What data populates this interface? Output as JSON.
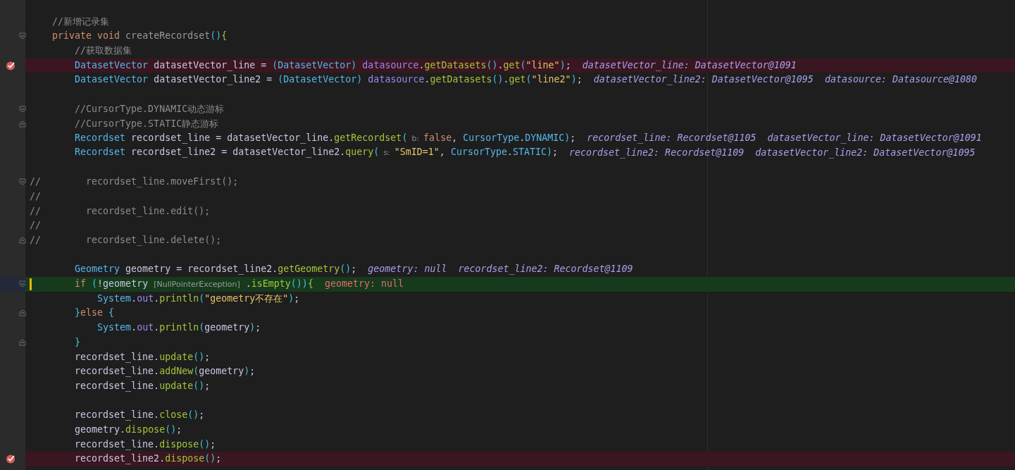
{
  "rows": [
    {
      "kind": "line",
      "breakpoint": false,
      "current": false
    },
    {
      "kind": "line",
      "breakpoint": false,
      "current": false,
      "indent": "    ",
      "tokens": [
        {
          "kind": "comment",
          "text": "//新增记录集"
        }
      ]
    },
    {
      "kind": "opener",
      "breakpoint": false,
      "current": false,
      "indent": "    ",
      "tokens": [
        {
          "kind": "keyword",
          "text": "private void "
        },
        {
          "kind": "unused",
          "text": "createRecordset"
        },
        {
          "kind": "paren",
          "text": "()"
        },
        {
          "kind": "brace",
          "text": "{"
        }
      ]
    },
    {
      "kind": "line",
      "breakpoint": false,
      "current": false,
      "indent": "        ",
      "tokens": [
        {
          "kind": "comment",
          "text": "//获取数据集"
        }
      ]
    },
    {
      "kind": "line",
      "breakpoint": true,
      "current": false,
      "indent": "        ",
      "tokens": [
        {
          "kind": "type",
          "text": "DatasetVector"
        },
        {
          "kind": "plain",
          "text": " datasetVector_line = "
        },
        {
          "kind": "paren",
          "text": "("
        },
        {
          "kind": "type",
          "text": "DatasetVector"
        },
        {
          "kind": "paren",
          "text": ")"
        },
        {
          "kind": "field",
          "text": " datasource"
        },
        {
          "kind": "plain",
          "text": "."
        },
        {
          "kind": "method",
          "text": "getDatasets"
        },
        {
          "kind": "paren",
          "text": "()"
        },
        {
          "kind": "plain",
          "text": "."
        },
        {
          "kind": "method",
          "text": "get"
        },
        {
          "kind": "paren",
          "text": "("
        },
        {
          "kind": "string",
          "text": "\"line\""
        },
        {
          "kind": "paren",
          "text": ")"
        },
        {
          "kind": "plain",
          "text": ";"
        }
      ],
      "values": [
        {
          "kind": "value",
          "text": "datasetVector_line: DatasetVector@1091"
        }
      ]
    },
    {
      "kind": "line",
      "breakpoint": false,
      "current": false,
      "indent": "        ",
      "tokens": [
        {
          "kind": "type",
          "text": "DatasetVector"
        },
        {
          "kind": "plain",
          "text": " datasetVector_line2 = "
        },
        {
          "kind": "paren",
          "text": "("
        },
        {
          "kind": "type",
          "text": "DatasetVector"
        },
        {
          "kind": "paren",
          "text": ")"
        },
        {
          "kind": "field",
          "text": " datasource"
        },
        {
          "kind": "plain",
          "text": "."
        },
        {
          "kind": "method",
          "text": "getDatasets"
        },
        {
          "kind": "paren",
          "text": "()"
        },
        {
          "kind": "plain",
          "text": "."
        },
        {
          "kind": "method",
          "text": "get"
        },
        {
          "kind": "paren",
          "text": "("
        },
        {
          "kind": "string",
          "text": "\"line2\""
        },
        {
          "kind": "paren",
          "text": ")"
        },
        {
          "kind": "plain",
          "text": ";"
        }
      ],
      "values": [
        {
          "kind": "value",
          "text": "datasetVector_line2: DatasetVector@1095"
        },
        {
          "kind": "value",
          "text": "datasource: Datasource@1080"
        }
      ]
    },
    {
      "kind": "line",
      "breakpoint": false,
      "current": false
    },
    {
      "kind": "opener",
      "breakpoint": false,
      "current": false,
      "indent": "        ",
      "tokens": [
        {
          "kind": "comment",
          "text": "//CursorType.DYNAMIC动态游标"
        }
      ]
    },
    {
      "kind": "closer",
      "breakpoint": false,
      "current": false,
      "indent": "        ",
      "tokens": [
        {
          "kind": "comment",
          "text": "//CursorType.STATIC静态游标"
        }
      ]
    },
    {
      "kind": "line",
      "breakpoint": false,
      "current": false,
      "indent": "        ",
      "tokens": [
        {
          "kind": "type",
          "text": "Recordset"
        },
        {
          "kind": "plain",
          "text": " recordset_line = datasetVector_line."
        },
        {
          "kind": "method",
          "text": "getRecordset"
        },
        {
          "kind": "paren",
          "text": "("
        },
        {
          "kind": "hint",
          "text": "b:"
        },
        {
          "kind": "keyword",
          "text": "false"
        },
        {
          "kind": "plain",
          "text": ", "
        },
        {
          "kind": "type",
          "text": "CursorType"
        },
        {
          "kind": "plain",
          "text": "."
        },
        {
          "kind": "constant",
          "text": "DYNAMIC"
        },
        {
          "kind": "paren",
          "text": ")"
        },
        {
          "kind": "plain",
          "text": ";"
        }
      ],
      "values": [
        {
          "kind": "value",
          "text": "recordset_line: Recordset@1105"
        },
        {
          "kind": "value",
          "text": "datasetVector_line: DatasetVector@1091"
        }
      ]
    },
    {
      "kind": "line",
      "breakpoint": false,
      "current": false,
      "indent": "        ",
      "tokens": [
        {
          "kind": "type",
          "text": "Recordset"
        },
        {
          "kind": "plain",
          "text": " recordset_line2 = datasetVector_line2."
        },
        {
          "kind": "method",
          "text": "query"
        },
        {
          "kind": "paren",
          "text": "("
        },
        {
          "kind": "hint",
          "text": "s:"
        },
        {
          "kind": "string",
          "text": "\"SmID=1\""
        },
        {
          "kind": "plain",
          "text": ", "
        },
        {
          "kind": "type",
          "text": "CursorType"
        },
        {
          "kind": "plain",
          "text": "."
        },
        {
          "kind": "constant",
          "text": "STATIC"
        },
        {
          "kind": "paren",
          "text": ")"
        },
        {
          "kind": "plain",
          "text": ";"
        }
      ],
      "values": [
        {
          "kind": "value",
          "text": "recordset_line2: Recordset@1109"
        },
        {
          "kind": "value",
          "text": "datasetVector_line2: DatasetVector@1095"
        }
      ]
    },
    {
      "kind": "line",
      "breakpoint": false,
      "current": false
    },
    {
      "kind": "opener",
      "breakpoint": false,
      "current": false,
      "tokens": [
        {
          "kind": "comment",
          "text": "//        recordset_line.moveFirst();"
        }
      ]
    },
    {
      "kind": "line",
      "breakpoint": false,
      "current": false,
      "tokens": [
        {
          "kind": "comment",
          "text": "//"
        }
      ]
    },
    {
      "kind": "line",
      "breakpoint": false,
      "current": false,
      "tokens": [
        {
          "kind": "comment",
          "text": "//        recordset_line.edit();"
        }
      ]
    },
    {
      "kind": "line",
      "breakpoint": false,
      "current": false,
      "tokens": [
        {
          "kind": "comment",
          "text": "//"
        }
      ]
    },
    {
      "kind": "closer",
      "breakpoint": false,
      "current": false,
      "tokens": [
        {
          "kind": "comment",
          "text": "//        recordset_line.delete();"
        }
      ]
    },
    {
      "kind": "line",
      "breakpoint": false,
      "current": false
    },
    {
      "kind": "line",
      "breakpoint": false,
      "current": false,
      "indent": "        ",
      "tokens": [
        {
          "kind": "type",
          "text": "Geometry"
        },
        {
          "kind": "plain",
          "text": " geometry = recordset_line2."
        },
        {
          "kind": "method",
          "text": "getGeometry"
        },
        {
          "kind": "paren",
          "text": "()"
        },
        {
          "kind": "plain",
          "text": ";"
        }
      ],
      "values": [
        {
          "kind": "value",
          "text": "geometry: null"
        },
        {
          "kind": "value",
          "text": "recordset_line2: Recordset@1109"
        }
      ]
    },
    {
      "kind": "opener",
      "breakpoint": false,
      "current": true,
      "indent": "        ",
      "tokens": [
        {
          "kind": "keyword",
          "text": "if "
        },
        {
          "kind": "paren",
          "text": "("
        },
        {
          "kind": "plain",
          "text": "!geometry "
        },
        {
          "kind": "badge",
          "text": "[NullPointerException]"
        },
        {
          "kind": "plain",
          "text": " ."
        },
        {
          "kind": "method",
          "text": "isEmpty"
        },
        {
          "kind": "paren",
          "text": "())"
        },
        {
          "kind": "brace",
          "text": "{"
        }
      ],
      "values": [
        {
          "kind": "error",
          "text": "geometry: null"
        }
      ]
    },
    {
      "kind": "line",
      "breakpoint": false,
      "current": false,
      "indent": "            ",
      "tokens": [
        {
          "kind": "type",
          "text": "System"
        },
        {
          "kind": "plain",
          "text": "."
        },
        {
          "kind": "field",
          "text": "out"
        },
        {
          "kind": "plain",
          "text": "."
        },
        {
          "kind": "method",
          "text": "println"
        },
        {
          "kind": "paren",
          "text": "("
        },
        {
          "kind": "string",
          "text": "\"geometry不存在\""
        },
        {
          "kind": "paren",
          "text": ")"
        },
        {
          "kind": "plain",
          "text": ";"
        }
      ]
    },
    {
      "kind": "closer",
      "breakpoint": false,
      "current": false,
      "indent": "        ",
      "tokens": [
        {
          "kind": "paren",
          "text": "}"
        },
        {
          "kind": "keyword",
          "text": "else "
        },
        {
          "kind": "paren",
          "text": "{"
        }
      ]
    },
    {
      "kind": "line",
      "breakpoint": false,
      "current": false,
      "indent": "            ",
      "tokens": [
        {
          "kind": "type",
          "text": "System"
        },
        {
          "kind": "plain",
          "text": "."
        },
        {
          "kind": "field",
          "text": "out"
        },
        {
          "kind": "plain",
          "text": "."
        },
        {
          "kind": "method",
          "text": "println"
        },
        {
          "kind": "paren",
          "text": "("
        },
        {
          "kind": "plain",
          "text": "geometry"
        },
        {
          "kind": "paren",
          "text": ")"
        },
        {
          "kind": "plain",
          "text": ";"
        }
      ]
    },
    {
      "kind": "closer",
      "breakpoint": false,
      "current": false,
      "indent": "        ",
      "tokens": [
        {
          "kind": "paren",
          "text": "}"
        }
      ]
    },
    {
      "kind": "line",
      "breakpoint": false,
      "current": false,
      "indent": "        ",
      "tokens": [
        {
          "kind": "plain",
          "text": "recordset_line."
        },
        {
          "kind": "method",
          "text": "update"
        },
        {
          "kind": "paren",
          "text": "()"
        },
        {
          "kind": "plain",
          "text": ";"
        }
      ]
    },
    {
      "kind": "line",
      "breakpoint": false,
      "current": false,
      "indent": "        ",
      "tokens": [
        {
          "kind": "plain",
          "text": "recordset_line."
        },
        {
          "kind": "method",
          "text": "addNew"
        },
        {
          "kind": "paren",
          "text": "("
        },
        {
          "kind": "plain",
          "text": "geometry"
        },
        {
          "kind": "paren",
          "text": ")"
        },
        {
          "kind": "plain",
          "text": ";"
        }
      ]
    },
    {
      "kind": "line",
      "breakpoint": false,
      "current": false,
      "indent": "        ",
      "tokens": [
        {
          "kind": "plain",
          "text": "recordset_line."
        },
        {
          "kind": "method",
          "text": "update"
        },
        {
          "kind": "paren",
          "text": "()"
        },
        {
          "kind": "plain",
          "text": ";"
        }
      ]
    },
    {
      "kind": "line",
      "breakpoint": false,
      "current": false
    },
    {
      "kind": "line",
      "breakpoint": false,
      "current": false,
      "indent": "        ",
      "tokens": [
        {
          "kind": "plain",
          "text": "recordset_line."
        },
        {
          "kind": "method",
          "text": "close"
        },
        {
          "kind": "paren",
          "text": "()"
        },
        {
          "kind": "plain",
          "text": ";"
        }
      ]
    },
    {
      "kind": "line",
      "breakpoint": false,
      "current": false,
      "indent": "        ",
      "tokens": [
        {
          "kind": "plain",
          "text": "geometry."
        },
        {
          "kind": "method",
          "text": "dispose"
        },
        {
          "kind": "paren",
          "text": "()"
        },
        {
          "kind": "plain",
          "text": ";"
        }
      ]
    },
    {
      "kind": "line",
      "breakpoint": false,
      "current": false,
      "indent": "        ",
      "tokens": [
        {
          "kind": "plain",
          "text": "recordset_line."
        },
        {
          "kind": "method",
          "text": "dispose"
        },
        {
          "kind": "paren",
          "text": "()"
        },
        {
          "kind": "plain",
          "text": ";"
        }
      ]
    },
    {
      "kind": "line",
      "breakpoint": true,
      "current": false,
      "indent": "        ",
      "tokens": [
        {
          "kind": "plain",
          "text": "recordset_line2."
        },
        {
          "kind": "method",
          "text": "dispose"
        },
        {
          "kind": "paren",
          "text": "()"
        },
        {
          "kind": "plain",
          "text": ";"
        }
      ]
    }
  ]
}
